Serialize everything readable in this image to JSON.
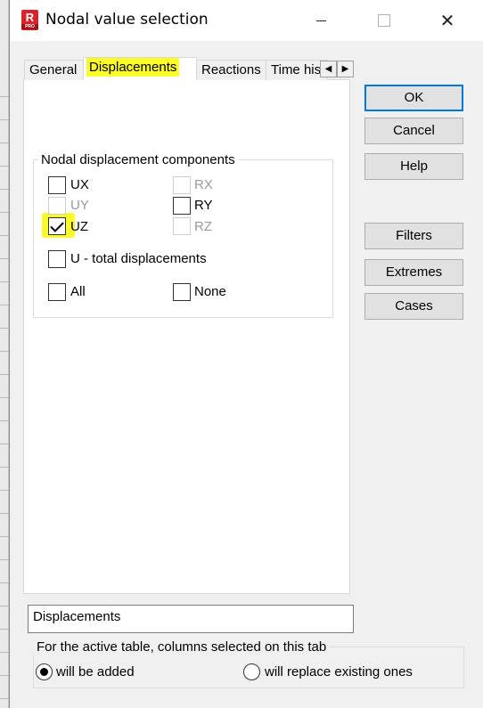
{
  "window": {
    "title": "Nodal value selection",
    "icon_letter": "R",
    "icon_sub": "PRO"
  },
  "tabs": [
    {
      "label": "General",
      "active": false
    },
    {
      "label": "Displacements",
      "active": true
    },
    {
      "label": "Reactions",
      "active": false
    },
    {
      "label": "Time his",
      "active": false
    }
  ],
  "group": {
    "legend": "Nodal displacement components",
    "checkboxes": {
      "ux": {
        "label": "UX",
        "checked": false,
        "enabled": true
      },
      "rx": {
        "label": "RX",
        "checked": false,
        "enabled": false
      },
      "uy": {
        "label": "UY",
        "checked": false,
        "enabled": false
      },
      "ry": {
        "label": "RY",
        "checked": false,
        "enabled": true
      },
      "uz": {
        "label": "UZ",
        "checked": true,
        "enabled": true
      },
      "rz": {
        "label": "RZ",
        "checked": false,
        "enabled": false
      },
      "u_total": {
        "label": "U - total displacements",
        "checked": false,
        "enabled": true
      },
      "all": {
        "label": "All",
        "checked": false,
        "enabled": true
      },
      "none": {
        "label": "None",
        "checked": false,
        "enabled": true
      }
    }
  },
  "buttons": {
    "ok": "OK",
    "cancel": "Cancel",
    "help": "Help",
    "filters": "Filters",
    "extremes": "Extremes",
    "cases": "Cases"
  },
  "description": "Displacements",
  "columns": {
    "legend": "For the active table, columns selected on this tab",
    "options": [
      {
        "label": "will be added",
        "selected": true
      },
      {
        "label": "will replace existing ones",
        "selected": false
      }
    ]
  },
  "colors": {
    "highlight": "#fbfb2a",
    "default_button_border": "#0078d7",
    "app_icon": "#d8232a"
  }
}
